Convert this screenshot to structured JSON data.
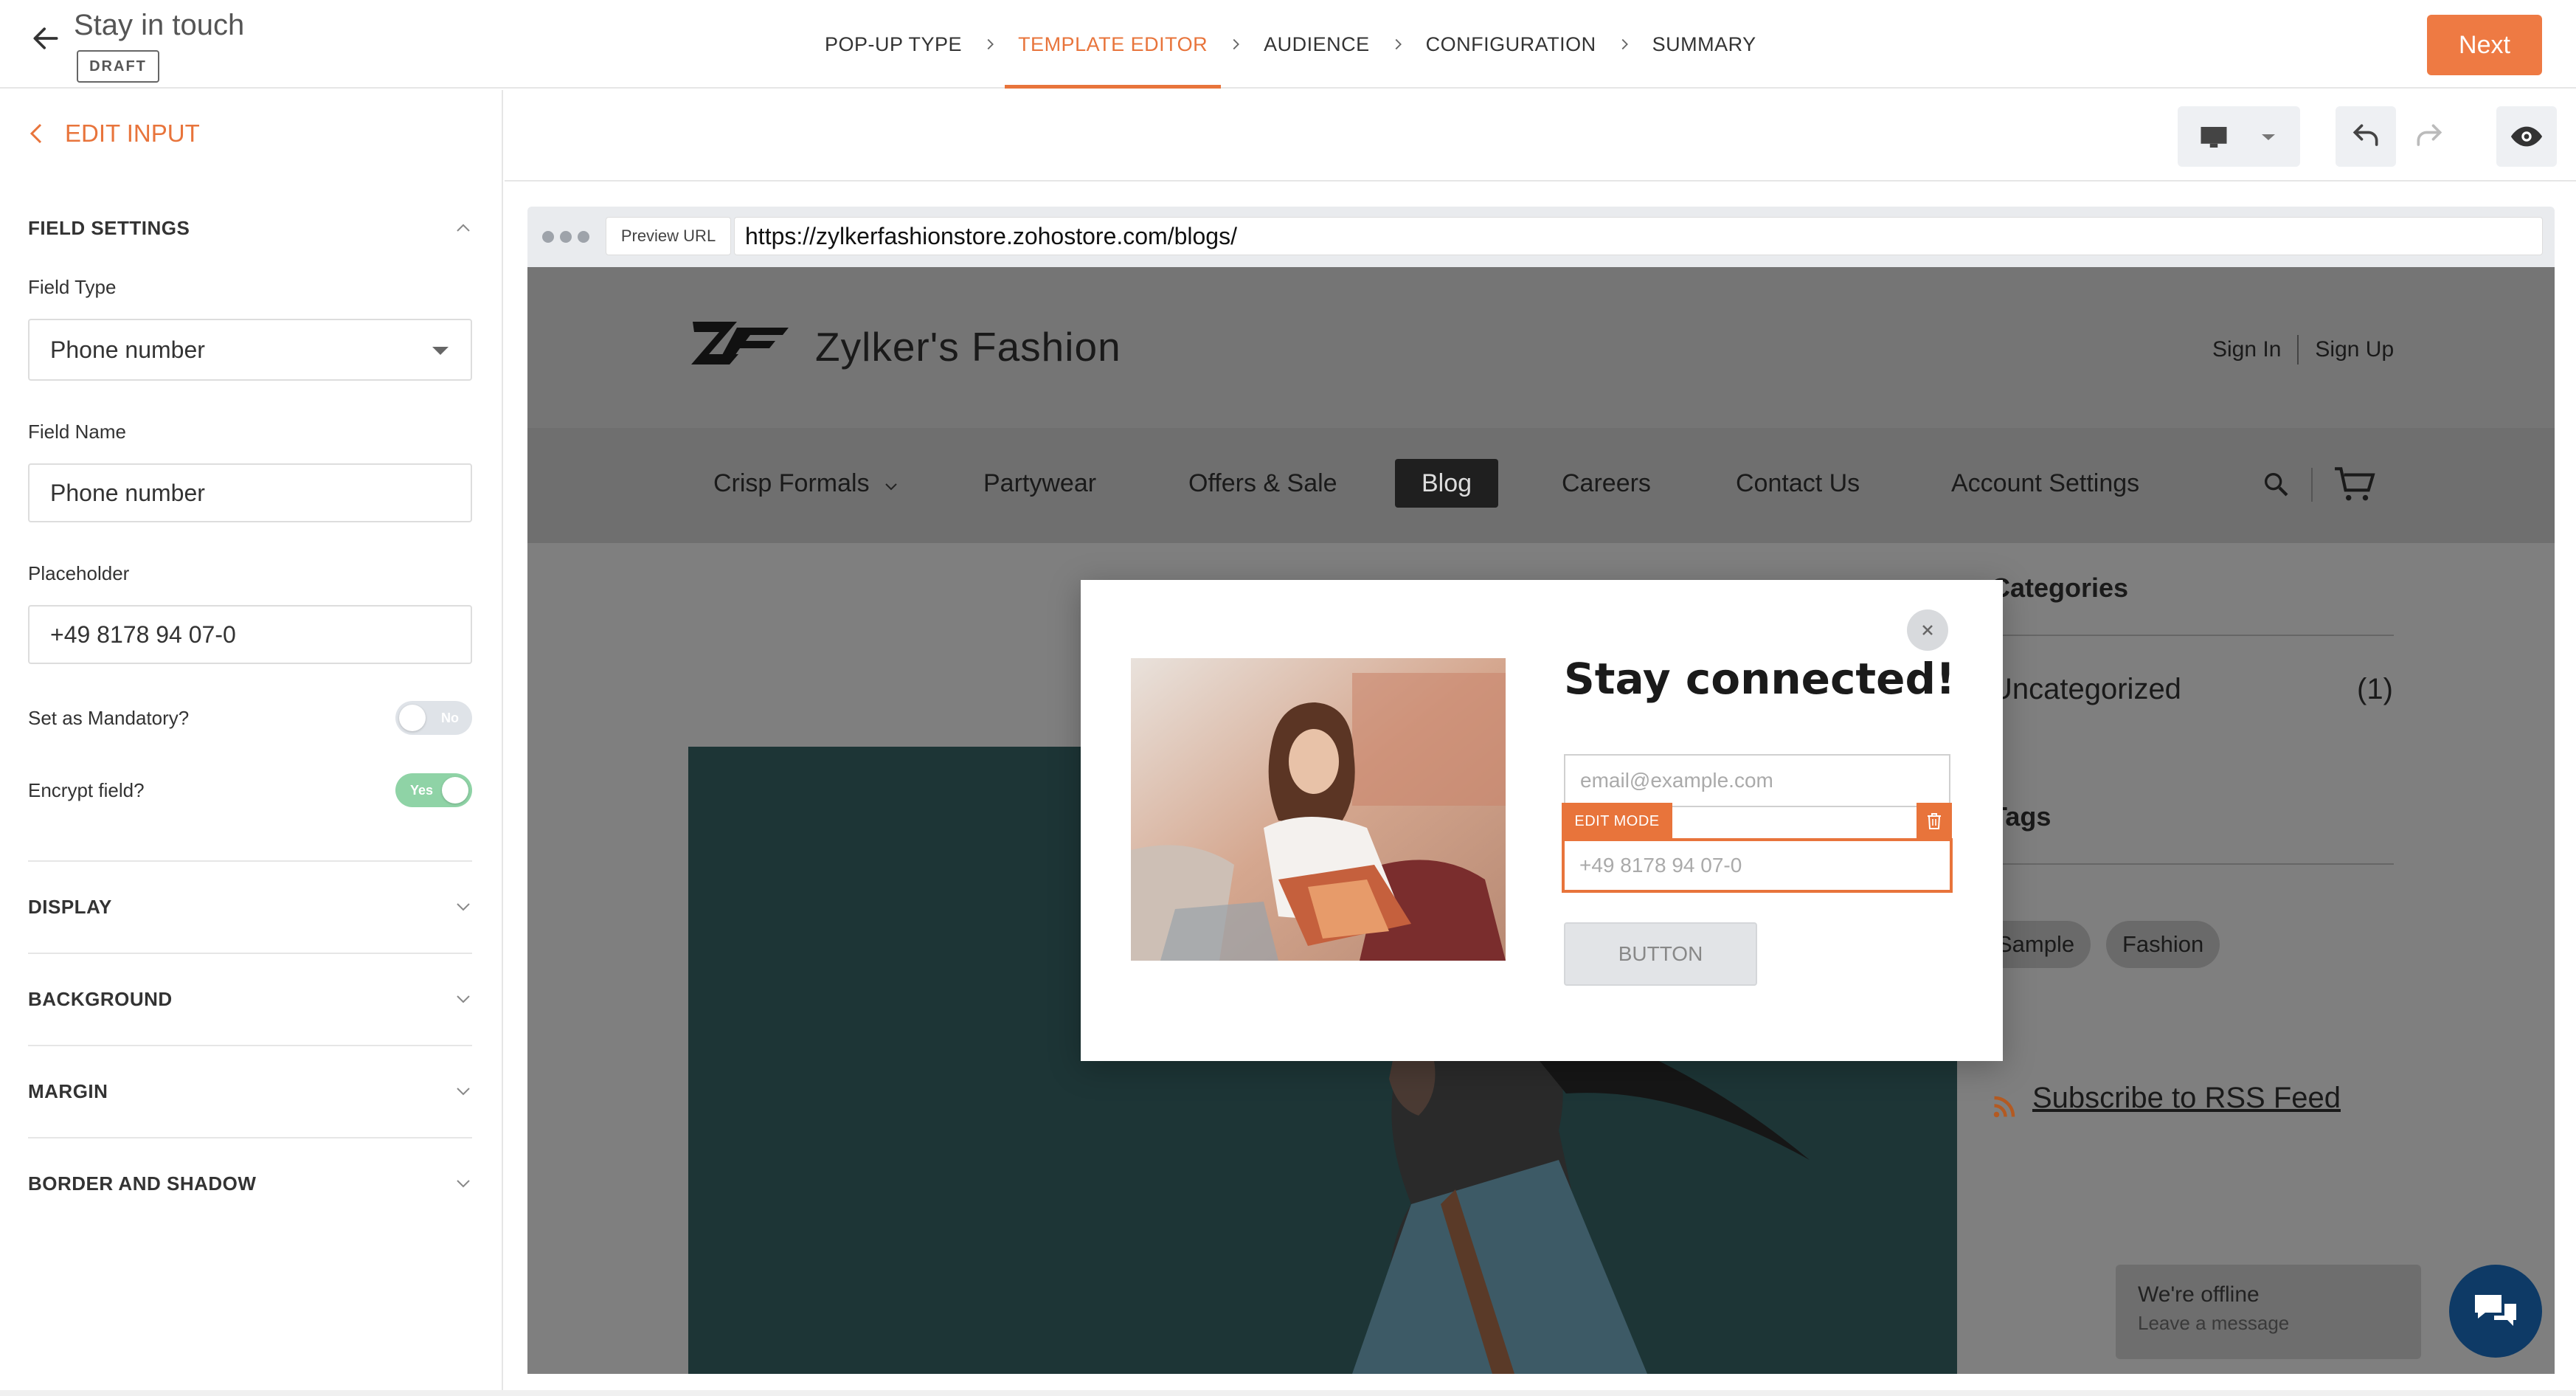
{
  "header": {
    "title": "Stay in touch",
    "status_badge": "DRAFT",
    "steps": [
      {
        "label": "POP-UP TYPE",
        "active": false
      },
      {
        "label": "TEMPLATE EDITOR",
        "active": true
      },
      {
        "label": "AUDIENCE",
        "active": false
      },
      {
        "label": "CONFIGURATION",
        "active": false
      },
      {
        "label": "SUMMARY",
        "active": false
      }
    ],
    "next_label": "Next"
  },
  "left_panel": {
    "back_label": "EDIT INPUT",
    "field_settings": {
      "heading": "FIELD SETTINGS",
      "field_type_label": "Field Type",
      "field_type_value": "Phone number",
      "field_name_label": "Field Name",
      "field_name_value": "Phone number",
      "placeholder_label": "Placeholder",
      "placeholder_value": "+49 8178 94 07-0",
      "mandatory_label": "Set as Mandatory?",
      "mandatory_state": "No",
      "encrypt_label": "Encrypt field?",
      "encrypt_state": "Yes"
    },
    "sections": [
      "DISPLAY",
      "BACKGROUND",
      "MARGIN",
      "BORDER AND SHADOW"
    ]
  },
  "toolbar": {
    "device_icon": "desktop-icon",
    "undo_icon": "undo-icon",
    "redo_icon": "redo-icon",
    "preview_icon": "eye-icon"
  },
  "browser": {
    "preview_label": "Preview URL",
    "url": "https://zylkerfashionstore.zohostore.com/blogs/"
  },
  "site": {
    "brand": "Zylker's Fashion",
    "sign_in": "Sign In",
    "sign_up": "Sign Up",
    "nav": [
      "Crisp Formals",
      "Partywear",
      "Offers & Sale",
      "Blog",
      "Careers",
      "Contact Us",
      "Account Settings"
    ],
    "sidebar": {
      "categories_heading": "Categories",
      "category_name": "Uncategorized",
      "category_count": "(1)",
      "tags_heading": "Tags",
      "tags": [
        "Sample",
        "Fashion"
      ],
      "rss_label": "Subscribe to RSS Feed"
    },
    "chat": {
      "title": "We're offline",
      "subtitle": "Leave a message"
    }
  },
  "popup": {
    "title": "Stay connected!",
    "email_placeholder": "email@example.com",
    "edit_mode_label": "EDIT MODE",
    "phone_placeholder": "+49 8178 94 07-0",
    "button_label": "BUTTON"
  },
  "colors": {
    "accent": "#e8743b",
    "next_button": "#ee7a43",
    "toggle_on": "#8fd3a6",
    "chat_fab": "#0e3a66"
  }
}
